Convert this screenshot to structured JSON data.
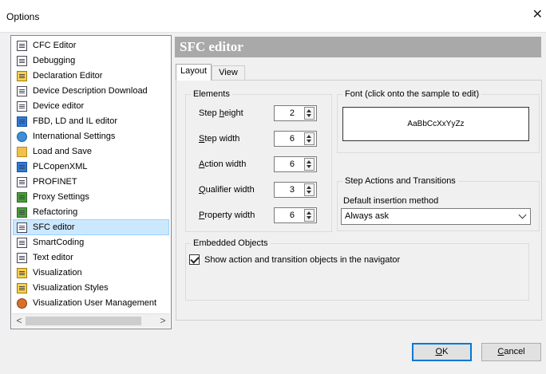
{
  "window": {
    "title": "Options",
    "close_glyph": "✕"
  },
  "tree": {
    "items": [
      {
        "label": "CFC Editor",
        "icon": "cfc-editor-icon"
      },
      {
        "label": "Debugging",
        "icon": "debugging-icon"
      },
      {
        "label": "Declaration Editor",
        "icon": "declaration-editor-icon"
      },
      {
        "label": "Device Description Download",
        "icon": "device-description-icon"
      },
      {
        "label": "Device editor",
        "icon": "device-editor-icon"
      },
      {
        "label": "FBD, LD and IL editor",
        "icon": "fbd-ld-il-icon"
      },
      {
        "label": "International Settings",
        "icon": "globe-icon"
      },
      {
        "label": "Load and Save",
        "icon": "folder-icon"
      },
      {
        "label": "PLCopenXML",
        "icon": "plcopenxml-icon"
      },
      {
        "label": "PROFINET",
        "icon": "profinet-icon"
      },
      {
        "label": "Proxy Settings",
        "icon": "proxy-icon"
      },
      {
        "label": "Refactoring",
        "icon": "refactoring-icon"
      },
      {
        "label": "SFC editor",
        "icon": "sfc-editor-icon"
      },
      {
        "label": "SmartCoding",
        "icon": "smartcoding-icon"
      },
      {
        "label": "Text editor",
        "icon": "text-editor-icon"
      },
      {
        "label": "Visualization",
        "icon": "visualization-icon"
      },
      {
        "label": "Visualization Styles",
        "icon": "visualization-styles-icon"
      },
      {
        "label": "Visualization User Management",
        "icon": "user-management-icon"
      }
    ],
    "selected": "SFC editor",
    "scroll_left": "<",
    "scroll_right": ">"
  },
  "panel": {
    "title": "SFC editor",
    "tabs": [
      "Layout",
      "View"
    ],
    "active_tab": "Layout",
    "elements": {
      "legend": "Elements",
      "rows": [
        {
          "pre": "Step ",
          "mn": "h",
          "post": "eight",
          "value": "2"
        },
        {
          "pre": "",
          "mn": "S",
          "post": "tep width",
          "value": "6"
        },
        {
          "pre": "",
          "mn": "A",
          "post": "ction width",
          "value": "6"
        },
        {
          "pre": "",
          "mn": "Q",
          "post": "ualifier width",
          "value": "3"
        },
        {
          "pre": "",
          "mn": "P",
          "post": "roperty width",
          "value": "6"
        }
      ]
    },
    "font": {
      "legend": "Font (click onto the sample to edit)",
      "sample": "AaBbCcXxYyZz"
    },
    "step_actions": {
      "legend": "Step Actions and Transitions",
      "insertion_label": "Default insertion method",
      "insertion_value": "Always ask"
    },
    "embedded": {
      "legend": "Embedded Objects",
      "checkbox_label": "Show action and transition objects in the navigator",
      "checked": true
    }
  },
  "buttons": {
    "ok": {
      "mn": "O",
      "rest": "K"
    },
    "cancel": {
      "mn": "C",
      "rest": "ancel"
    }
  }
}
